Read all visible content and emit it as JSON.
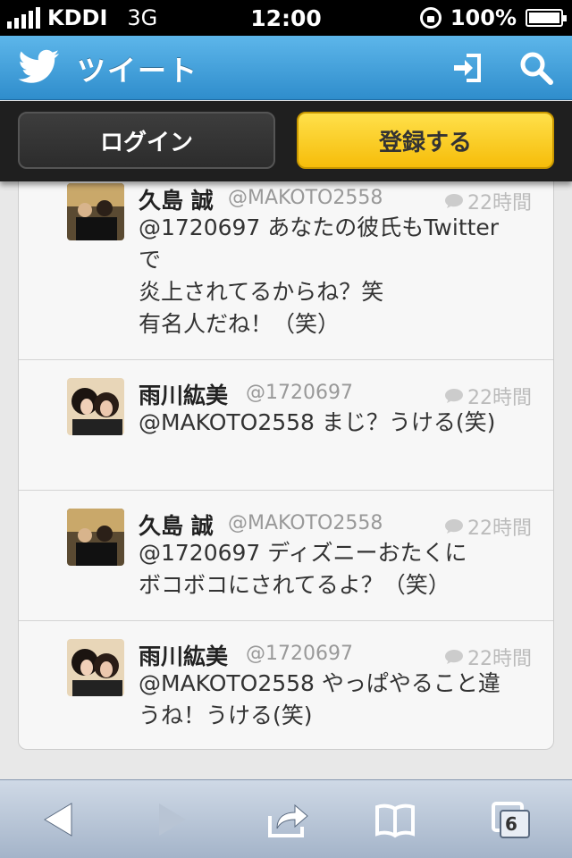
{
  "status_bar": {
    "carrier": "KDDI",
    "network": "3G",
    "time": "12:00",
    "battery": "100%"
  },
  "header": {
    "title": "ツイート"
  },
  "auth": {
    "login_label": "ログイン",
    "register_label": "登録する"
  },
  "tweets": [
    {
      "name": "久島 誠",
      "handle": "@MAKOTO2558",
      "time": "22時間",
      "lines": [
        "@1720697 あなたの彼氏もTwitter",
        "で",
        "炎上されてるからね？笑",
        "有名人だね！（笑）"
      ]
    },
    {
      "name": "雨川紘美",
      "handle": "@1720697",
      "time": "22時間",
      "lines": [
        "@MAKOTO2558 まじ？うける(笑)"
      ]
    },
    {
      "name": "久島 誠",
      "handle": "@MAKOTO2558",
      "time": "22時間",
      "lines": [
        "@1720697 ディズニーおたくに",
        "ボコボコにされてるよ？（笑）"
      ]
    },
    {
      "name": "雨川紘美",
      "handle": "@1720697",
      "time": "22時間",
      "lines": [
        "@MAKOTO2558 やっぱやること違",
        "うね！うける(笑)"
      ]
    }
  ],
  "toolbar": {
    "tabs_count": "6"
  },
  "icons": [
    "twitter-bird-icon",
    "sign-in-icon",
    "search-icon",
    "reply-bubble-icon",
    "back-arrow-icon",
    "forward-arrow-icon",
    "share-icon",
    "bookmarks-icon",
    "tabs-icon"
  ],
  "colors": {
    "header_blue": "#3a9ad9",
    "register_yellow": "#f8c81c",
    "auth_bar": "#1f1f1f"
  }
}
